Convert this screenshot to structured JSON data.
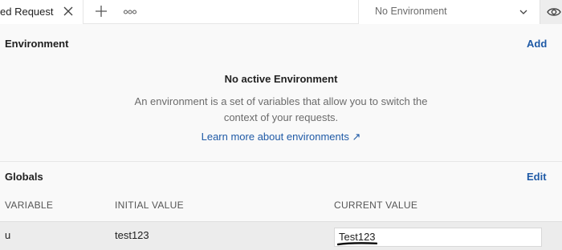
{
  "tab": {
    "label": "ed Request"
  },
  "env_selector": {
    "value": "No Environment"
  },
  "environment": {
    "title": "Environment",
    "add_label": "Add",
    "empty_title": "No active Environment",
    "empty_desc_line1": "An environment is a set of variables that allow you to switch the",
    "empty_desc_line2": "context of your requests.",
    "learn_more": "Learn more about environments ↗"
  },
  "globals": {
    "title": "Globals",
    "edit_label": "Edit",
    "columns": [
      "VARIABLE",
      "INITIAL VALUE",
      "CURRENT VALUE"
    ],
    "rows": [
      {
        "variable": "u",
        "initial_value": "test123",
        "current_value": "Test123"
      }
    ]
  },
  "icons": {
    "tab_close": "close-icon",
    "add_tab": "plus-icon",
    "more_tabs": "more-horizontal-icon",
    "env_dropdown": "chevron-down-icon",
    "env_quick_look": "eye-icon"
  },
  "colors": {
    "link": "#1f5aa6",
    "background": "#f9f9f9",
    "row_background": "#ececec"
  }
}
